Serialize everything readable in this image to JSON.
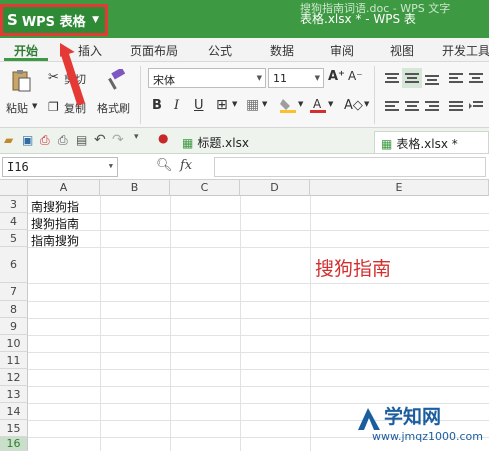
{
  "titlebar": {
    "app_name": "WPS 表格",
    "title": "表格.xlsx * - WPS 表",
    "background_title": "搜狗指南词语.doc - WPS 文字"
  },
  "tabs": [
    {
      "label": "开始",
      "active": true
    },
    {
      "label": "插入"
    },
    {
      "label": "页面布局"
    },
    {
      "label": "公式"
    },
    {
      "label": "数据"
    },
    {
      "label": "审阅"
    },
    {
      "label": "视图"
    },
    {
      "label": "开发工具"
    }
  ],
  "ribbon": {
    "paste": "粘贴",
    "cut": "剪切",
    "copy": "复制",
    "format_painter": "格式刷",
    "font_name": "宋体",
    "font_size": "11",
    "bold": "B",
    "italic": "I",
    "underline": "U"
  },
  "doc_tabs": [
    {
      "label": "标题.xlsx"
    },
    {
      "label": "表格.xlsx *",
      "active": true
    }
  ],
  "formula_bar": {
    "name_box": "I16",
    "fx": "fx",
    "value": ""
  },
  "grid": {
    "columns": [
      "A",
      "B",
      "C",
      "D",
      "E"
    ],
    "rows": [
      "3",
      "4",
      "5",
      "6",
      "7",
      "8",
      "9",
      "10",
      "11",
      "12",
      "13",
      "14",
      "15",
      "16"
    ],
    "active_row": "16",
    "cells": {
      "A3": "南搜狗指",
      "A4": "搜狗指南",
      "A5": "指南搜狗",
      "E6": "搜狗指南"
    }
  },
  "watermark": {
    "title": "学知网",
    "url": "www.jmqz1000.com"
  },
  "colors": {
    "titlebar": "#3d9a42",
    "accent_red": "#d32f2f",
    "highlight": "#e53935"
  }
}
